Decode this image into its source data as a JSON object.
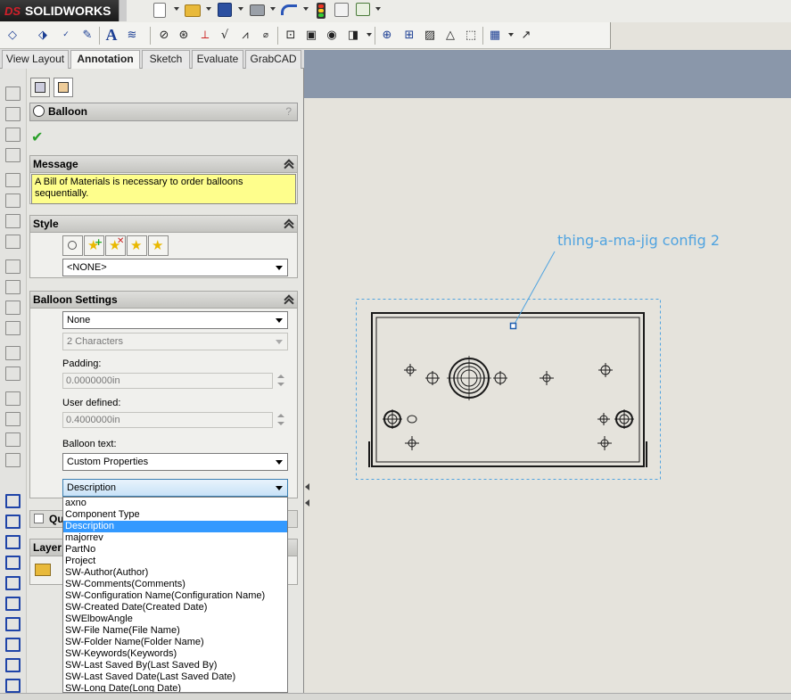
{
  "app": {
    "logo_prefix": "DS",
    "logo_name": "SOLIDWORKS"
  },
  "tabs": [
    {
      "label": "View Layout"
    },
    {
      "label": "Annotation"
    },
    {
      "label": "Sketch"
    },
    {
      "label": "Evaluate"
    },
    {
      "label": "GrabCAD"
    }
  ],
  "property_manager": {
    "title": "Balloon",
    "help": "?",
    "ok_icon": "check-icon",
    "message": {
      "header": "Message",
      "text": "A Bill of Materials is necessary to order balloons sequentially."
    },
    "style": {
      "header": "Style",
      "value": "<NONE>"
    },
    "balloon_settings": {
      "header": "Balloon Settings",
      "style_value": "None",
      "size_value": "2 Characters",
      "padding_label": "Padding:",
      "padding_value": "0.0000000in",
      "user_defined_label": "User defined:",
      "user_defined_value": "0.4000000in",
      "balloon_text_label": "Balloon text:",
      "balloon_text_value": "Custom Properties",
      "property_value": "Description"
    },
    "quantity": {
      "label": "Qu"
    },
    "layer": {
      "header": "Layer"
    }
  },
  "dropdown_options": [
    "axno",
    "Component Type",
    "Description",
    "majorrev",
    "PartNo",
    "Project",
    "SW-Author(Author)",
    "SW-Comments(Comments)",
    "SW-Configuration Name(Configuration Name)",
    "SW-Created Date(Created Date)",
    "SWElbowAngle",
    "SW-File Name(File Name)",
    "SW-Folder Name(Folder Name)",
    "SW-Keywords(Keywords)",
    "SW-Last Saved By(Last Saved By)",
    "SW-Last Saved Date(Last Saved Date)",
    "SW-Long Date(Long Date)"
  ],
  "selected_option_index": 2,
  "graphics": {
    "balloon_text": "thing-a-ma-jig config 2"
  },
  "colors": {
    "selection": "#3399ff",
    "message_bg": "#fefe8c",
    "graphics_bg": "#e5e3dc",
    "leader": "#4fa3e0"
  }
}
